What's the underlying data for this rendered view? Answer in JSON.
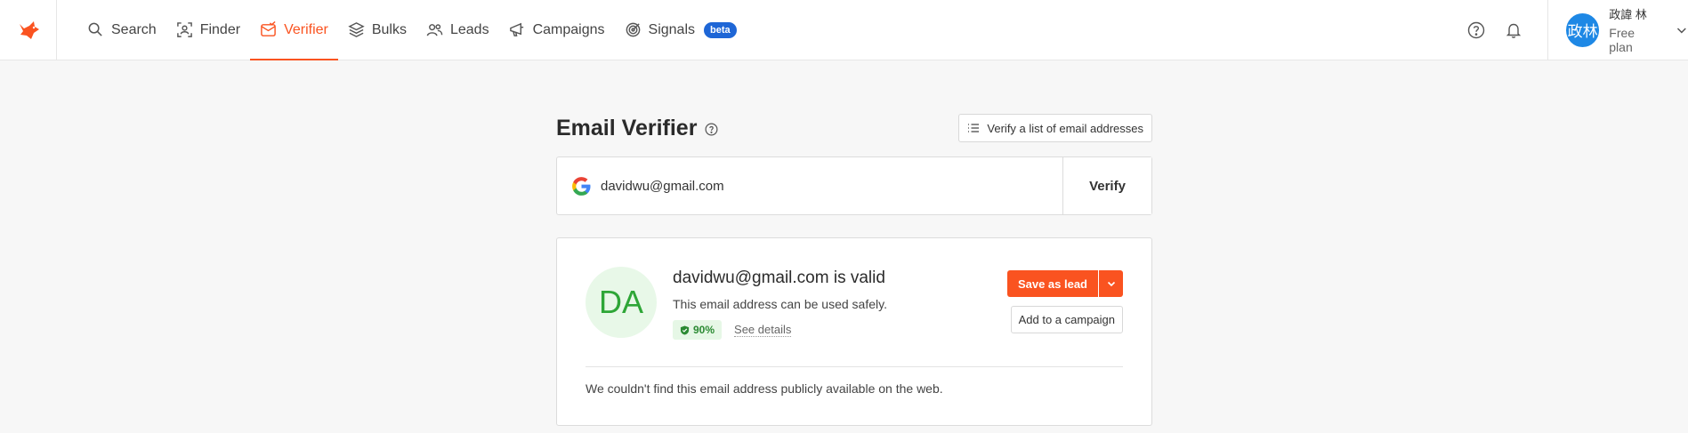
{
  "nav": {
    "items": [
      {
        "label": "Search",
        "icon": "search-icon"
      },
      {
        "label": "Finder",
        "icon": "finder-icon"
      },
      {
        "label": "Verifier",
        "icon": "verifier-icon"
      },
      {
        "label": "Bulks",
        "icon": "bulks-icon"
      },
      {
        "label": "Leads",
        "icon": "leads-icon"
      },
      {
        "label": "Campaigns",
        "icon": "campaigns-icon"
      },
      {
        "label": "Signals",
        "icon": "signals-icon"
      }
    ],
    "active": "Verifier",
    "signals_badge": "beta",
    "accent_color": "#fa5320"
  },
  "user": {
    "avatar_text": "政林",
    "name": "政諱 林",
    "plan": "Free plan"
  },
  "verifier": {
    "title": "Email Verifier",
    "list_button_label": "Verify a list of email addresses",
    "email_value": "davidwu@gmail.com",
    "verify_button_label": "Verify"
  },
  "result": {
    "initials": "DA",
    "headline": "davidwu@gmail.com is valid",
    "description": "This email address can be used safely.",
    "score": "90%",
    "see_details_label": "See details",
    "save_lead_label": "Save as lead",
    "add_campaign_label": "Add to a campaign",
    "footnote": "We couldn't find this email address publicly available on the web."
  }
}
